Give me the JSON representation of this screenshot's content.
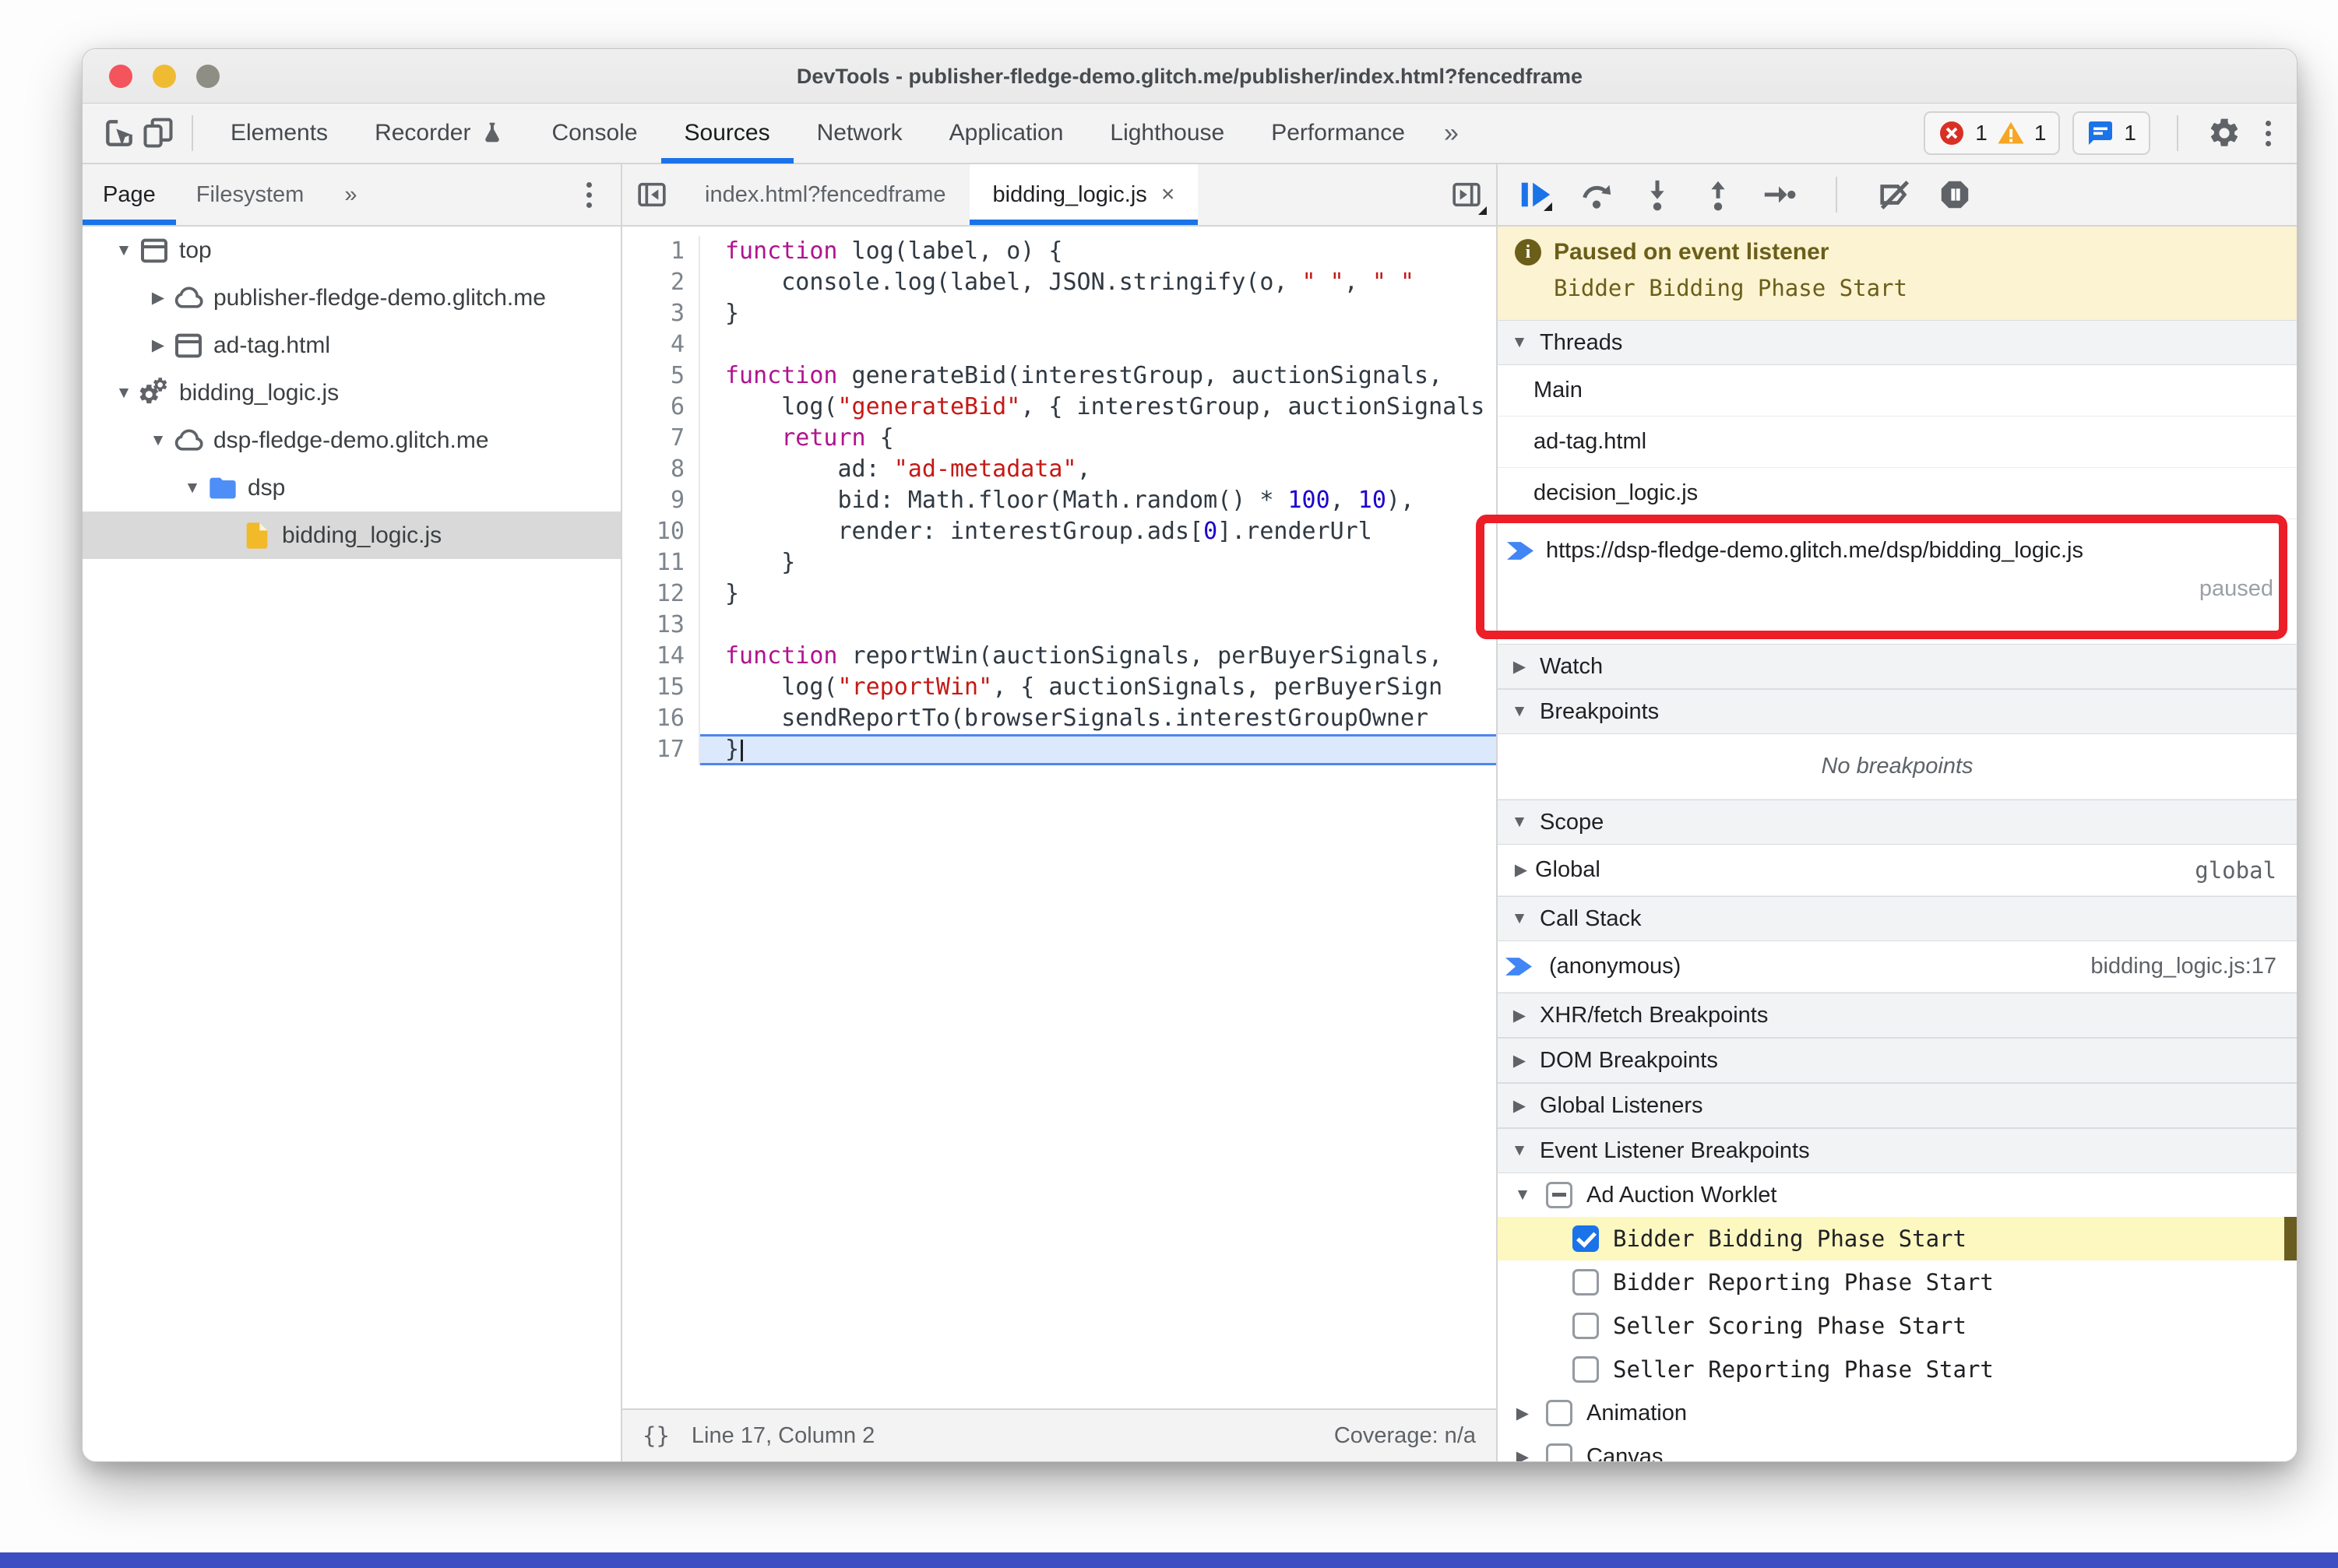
{
  "window": {
    "title": "DevTools - publisher-fledge-demo.glitch.me/publisher/index.html?fencedframe",
    "controls": [
      "close",
      "minimize",
      "zoom"
    ]
  },
  "colors": {
    "accent_blue": "#1a73e8",
    "annotation_red": "#ec1e27",
    "paused_banner_bg": "#fbf3d1",
    "paused_banner_text": "#6b5e19",
    "breakpoint_highlight": "#fdf7c0",
    "folder_blue": "#4d8ef7",
    "file_yellow": "#f2b928",
    "error_red": "#d93025",
    "warning_yellow": "#f5a623",
    "desktop_strip_blue": "#3c4ec2"
  },
  "toolbar": {
    "tabs": [
      {
        "label": "Elements",
        "active": false
      },
      {
        "label": "Recorder",
        "active": false,
        "icon": "flask-icon"
      },
      {
        "label": "Console",
        "active": false
      },
      {
        "label": "Sources",
        "active": true
      },
      {
        "label": "Network",
        "active": false
      },
      {
        "label": "Application",
        "active": false
      },
      {
        "label": "Lighthouse",
        "active": false
      },
      {
        "label": "Performance",
        "active": false
      }
    ],
    "more_tabs_label": "»",
    "badges": {
      "errors": "1",
      "warnings": "1",
      "issues": "1"
    }
  },
  "navigator": {
    "tabs": [
      "Page",
      "Filesystem"
    ],
    "active_tab": "Page",
    "more_label": "»",
    "tree": [
      {
        "label": "top",
        "icon": "window-icon",
        "expand": "open",
        "level": 0
      },
      {
        "label": "publisher-fledge-demo.glitch.me",
        "icon": "cloud-icon",
        "expand": "closed",
        "level": 1
      },
      {
        "label": "ad-tag.html",
        "icon": "window-icon",
        "expand": "closed",
        "level": 1
      },
      {
        "label": "bidding_logic.js",
        "icon": "worklet-icon",
        "expand": "open",
        "level": 0
      },
      {
        "label": "dsp-fledge-demo.glitch.me",
        "icon": "cloud-icon",
        "expand": "open",
        "level": 1
      },
      {
        "label": "dsp",
        "icon": "folder-icon",
        "expand": "open",
        "level": 2
      },
      {
        "label": "bidding_logic.js",
        "icon": "file-icon",
        "expand": "none",
        "level": 3,
        "selected": true
      }
    ]
  },
  "editor": {
    "tabs": [
      {
        "label": "index.html?fencedframe",
        "active": false
      },
      {
        "label": "bidding_logic.js",
        "active": true,
        "close_label": "×"
      }
    ],
    "current_line": 17,
    "lines": [
      {
        "n": 1,
        "seg": [
          [
            "k",
            "function"
          ],
          [
            "p",
            " log(label, o) {"
          ]
        ]
      },
      {
        "n": 2,
        "seg": [
          [
            "p",
            "    console.log(label, JSON.stringify(o, "
          ],
          [
            "s",
            "\" \""
          ],
          [
            "p",
            ", "
          ],
          [
            "s",
            "\" \""
          ]
        ]
      },
      {
        "n": 3,
        "seg": [
          [
            "p",
            "}"
          ]
        ]
      },
      {
        "n": 4,
        "seg": []
      },
      {
        "n": 5,
        "seg": [
          [
            "k",
            "function"
          ],
          [
            "p",
            " generateBid(interestGroup, auctionSignals, "
          ]
        ]
      },
      {
        "n": 6,
        "seg": [
          [
            "p",
            "    log("
          ],
          [
            "s",
            "\"generateBid\""
          ],
          [
            "p",
            ", { interestGroup, auctionSignals"
          ]
        ]
      },
      {
        "n": 7,
        "seg": [
          [
            "p",
            "    "
          ],
          [
            "k",
            "return"
          ],
          [
            "p",
            " {"
          ]
        ]
      },
      {
        "n": 8,
        "seg": [
          [
            "p",
            "        ad: "
          ],
          [
            "s",
            "\"ad-metadata\""
          ],
          [
            "p",
            ","
          ]
        ]
      },
      {
        "n": 9,
        "seg": [
          [
            "p",
            "        bid: Math.floor(Math.random() * "
          ],
          [
            "n2",
            "100"
          ],
          [
            "p",
            ", "
          ],
          [
            "n2",
            "10"
          ],
          [
            "p",
            "),"
          ]
        ]
      },
      {
        "n": 10,
        "seg": [
          [
            "p",
            "        render: interestGroup.ads["
          ],
          [
            "n2",
            "0"
          ],
          [
            "p",
            "].renderUrl"
          ]
        ]
      },
      {
        "n": 11,
        "seg": [
          [
            "p",
            "    }"
          ]
        ]
      },
      {
        "n": 12,
        "seg": [
          [
            "p",
            "}"
          ]
        ]
      },
      {
        "n": 13,
        "seg": []
      },
      {
        "n": 14,
        "seg": [
          [
            "k",
            "function"
          ],
          [
            "p",
            " reportWin(auctionSignals, perBuyerSignals, "
          ]
        ]
      },
      {
        "n": 15,
        "seg": [
          [
            "p",
            "    log("
          ],
          [
            "s",
            "\"reportWin\""
          ],
          [
            "p",
            ", { auctionSignals, perBuyerSign"
          ]
        ]
      },
      {
        "n": 16,
        "seg": [
          [
            "p",
            "    sendReportTo(browserSignals.interestGroupOwner"
          ]
        ]
      },
      {
        "n": 17,
        "seg": [
          [
            "p",
            "}"
          ]
        ]
      }
    ],
    "status": {
      "brackets": "{}",
      "line_col": "Line 17, Column 2",
      "coverage": "Coverage: n/a"
    }
  },
  "debugger": {
    "toolbar_icons": [
      "resume-icon",
      "step-over-icon",
      "step-into-icon",
      "step-out-icon",
      "step-icon",
      "divider",
      "deactivate-breakpoints-icon",
      "pause-on-exceptions-icon"
    ],
    "banner": {
      "title": "Paused on event listener",
      "detail": "Bidder Bidding Phase Start"
    },
    "threads": {
      "label": "Threads",
      "items": [
        {
          "label": "Main"
        },
        {
          "label": "ad-tag.html"
        },
        {
          "label": "decision_logic.js"
        },
        {
          "label": "https://dsp-fledge-demo.glitch.me/dsp/bidding_logic.js",
          "status": "paused",
          "active": true,
          "annotated": true
        }
      ]
    },
    "watch": {
      "label": "Watch",
      "expanded": false
    },
    "breakpoints": {
      "label": "Breakpoints",
      "expanded": true,
      "empty_text": "No breakpoints"
    },
    "scope": {
      "label": "Scope",
      "expanded": true,
      "rows": [
        {
          "label": "Global",
          "value": "global"
        }
      ]
    },
    "call_stack": {
      "label": "Call Stack",
      "expanded": true,
      "rows": [
        {
          "label": "(anonymous)",
          "location": "bidding_logic.js:17",
          "current": true
        }
      ]
    },
    "xhr_breakpoints": {
      "label": "XHR/fetch Breakpoints",
      "expanded": false
    },
    "dom_breakpoints": {
      "label": "DOM Breakpoints",
      "expanded": false
    },
    "global_listeners": {
      "label": "Global Listeners",
      "expanded": false
    },
    "event_listener_breakpoints": {
      "label": "Event Listener Breakpoints",
      "expanded": true,
      "groups": [
        {
          "label": "Ad Auction Worklet",
          "state": "indeterminate",
          "expanded": true,
          "children": [
            {
              "label": "Bidder Bidding Phase Start",
              "checked": true,
              "highlighted": true
            },
            {
              "label": "Bidder Reporting Phase Start",
              "checked": false
            },
            {
              "label": "Seller Scoring Phase Start",
              "checked": false
            },
            {
              "label": "Seller Reporting Phase Start",
              "checked": false
            }
          ]
        },
        {
          "label": "Animation",
          "state": "unchecked",
          "expanded": false,
          "children": []
        },
        {
          "label": "Canvas",
          "state": "unchecked",
          "expanded": false,
          "children": []
        }
      ]
    }
  }
}
